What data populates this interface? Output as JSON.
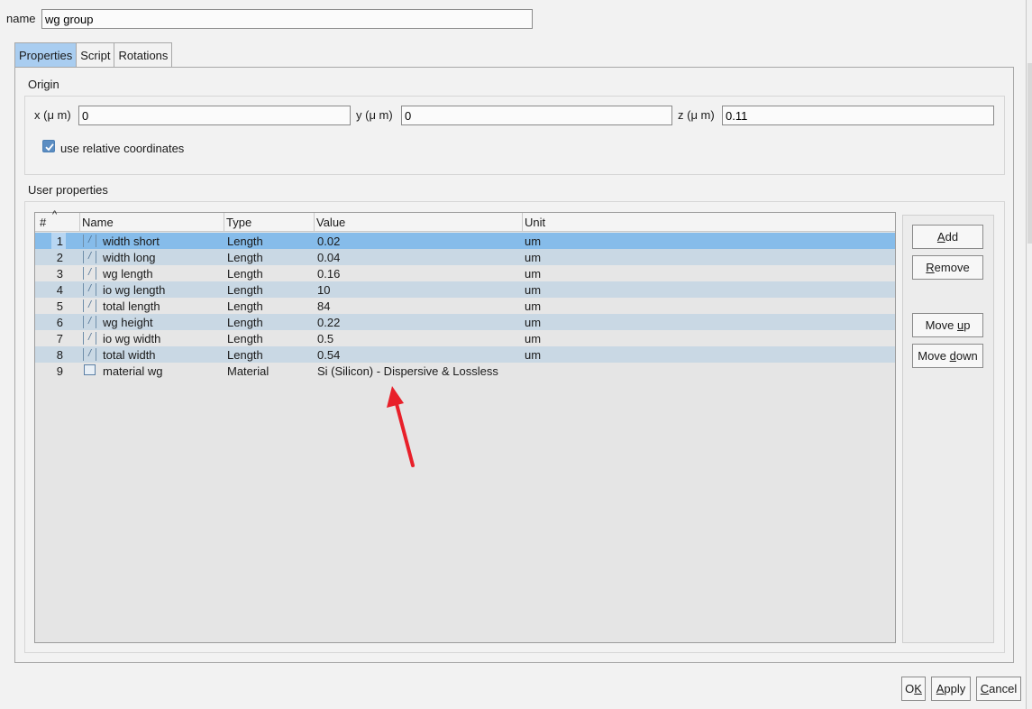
{
  "header": {
    "name_label": "name",
    "name_value": "wg group"
  },
  "tabs": [
    {
      "label": "Properties",
      "active": true
    },
    {
      "label": "Script",
      "active": false
    },
    {
      "label": "Rotations",
      "active": false
    }
  ],
  "origin": {
    "title": "Origin",
    "x_label": "x (μ m)",
    "x_value": "0",
    "y_label": "y (μ m)",
    "y_value": "0",
    "z_label": "z (μ m)",
    "z_value": "0.11",
    "relative_label": "use relative coordinates",
    "relative_checked": true
  },
  "user_properties": {
    "title": "User properties",
    "columns": [
      "#",
      "Name",
      "Type",
      "Value",
      "Unit"
    ],
    "rows": [
      {
        "num": "1",
        "name": "width short",
        "type": "Length",
        "value": "0.02",
        "unit": "um",
        "icon": "length-icon"
      },
      {
        "num": "2",
        "name": "width long",
        "type": "Length",
        "value": "0.04",
        "unit": "um",
        "icon": "length-icon"
      },
      {
        "num": "3",
        "name": "wg length",
        "type": "Length",
        "value": "0.16",
        "unit": "um",
        "icon": "length-icon"
      },
      {
        "num": "4",
        "name": "io wg length",
        "type": "Length",
        "value": "10",
        "unit": "um",
        "icon": "length-icon"
      },
      {
        "num": "5",
        "name": "total length",
        "type": "Length",
        "value": "84",
        "unit": "um",
        "icon": "length-icon"
      },
      {
        "num": "6",
        "name": "wg height",
        "type": "Length",
        "value": "0.22",
        "unit": "um",
        "icon": "length-icon"
      },
      {
        "num": "7",
        "name": "io wg width",
        "type": "Length",
        "value": "0.5",
        "unit": "um",
        "icon": "length-icon"
      },
      {
        "num": "8",
        "name": "total width",
        "type": "Length",
        "value": "0.54",
        "unit": "um",
        "icon": "length-icon"
      },
      {
        "num": "9",
        "name": "material wg",
        "type": "Material",
        "value": "Si (Silicon) - Dispersive & Lossless",
        "unit": "",
        "icon": "material-icon"
      }
    ],
    "selected_row": 1
  },
  "side_buttons": {
    "add": {
      "pre": "",
      "u": "A",
      "post": "dd"
    },
    "remove": {
      "pre": "",
      "u": "R",
      "post": "emove"
    },
    "move_up": {
      "pre": "Move ",
      "u": "u",
      "post": "p"
    },
    "move_down": {
      "pre": "Move ",
      "u": "d",
      "post": "own"
    }
  },
  "footer_buttons": {
    "ok": {
      "pre": "O",
      "u": "K",
      "post": ""
    },
    "apply": {
      "pre": "",
      "u": "A",
      "post": "pply"
    },
    "cancel": {
      "pre": "",
      "u": "C",
      "post": "ancel"
    }
  },
  "colors": {
    "selected_row": "#86bcea",
    "active_tab": "#a9cdf0",
    "annotation_arrow": "#e8202a"
  }
}
